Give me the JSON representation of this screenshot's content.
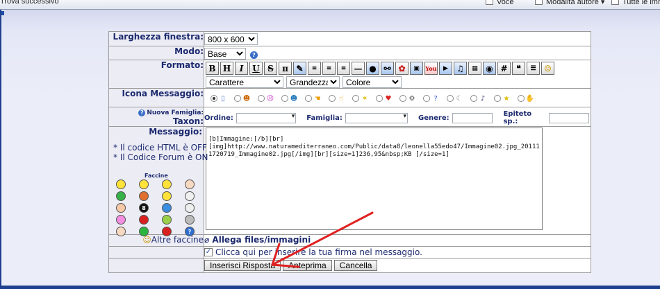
{
  "browser_toolbar": {
    "find_next": "Trova successivo",
    "voice": "Voce",
    "author_mode": "Modalità autore",
    "all_images": "Tutte le imm"
  },
  "form": {
    "window_width": {
      "label": "Larghezza finestra:",
      "value": "800 x 600"
    },
    "mode": {
      "label": "Modo:",
      "value": "Base"
    },
    "format": {
      "label": "Formato:",
      "buttons": [
        "B",
        "H",
        "I",
        "U",
        "S",
        "π",
        "",
        "",
        "",
        "",
        "",
        "",
        "",
        "",
        "",
        "",
        "",
        "",
        "",
        "",
        "#",
        "❝",
        "",
        ""
      ],
      "font_select": "Carattere",
      "size_select": "Grandezza",
      "color_select": "Colore"
    },
    "message_icon": {
      "label": "Icona Messaggio:"
    },
    "taxon": {
      "new_family_link": "Nuova Famiglia:",
      "label": "Taxon:",
      "order_label": "Ordine:",
      "family_label": "Famiglia:",
      "genus_label": "Genere:",
      "epithet_label": "Epiteto sp.:"
    },
    "message": {
      "label": "Messaggio:",
      "html_notice": "* Il codice HTML è OFF",
      "forum_notice": "* Il Codice Forum è ON",
      "smilies_title": "Faccine",
      "body": "[b]Immagine:[/b][br][img]http://www.naturamediterraneo.com/Public/data8/leonella55edo47/Immagine02.jpg_201111720719_Immagine02.jpg[/img][br][size=1]236,95&nbsp;KB [/size=1]"
    },
    "more_smilies": "Altre faccine",
    "attach_link": "Allega files/immagini",
    "signature_checkbox": "Clicca qui per inserire la tua firma nel messaggio.",
    "buttons": {
      "submit": "Inserisci Risposta",
      "preview": "Anteprima",
      "cancel": "Cancella"
    }
  },
  "colors": {
    "label_text": "#1c2a6e",
    "label_bg": "#ececf5",
    "annotation_arrow": "#e02020"
  }
}
